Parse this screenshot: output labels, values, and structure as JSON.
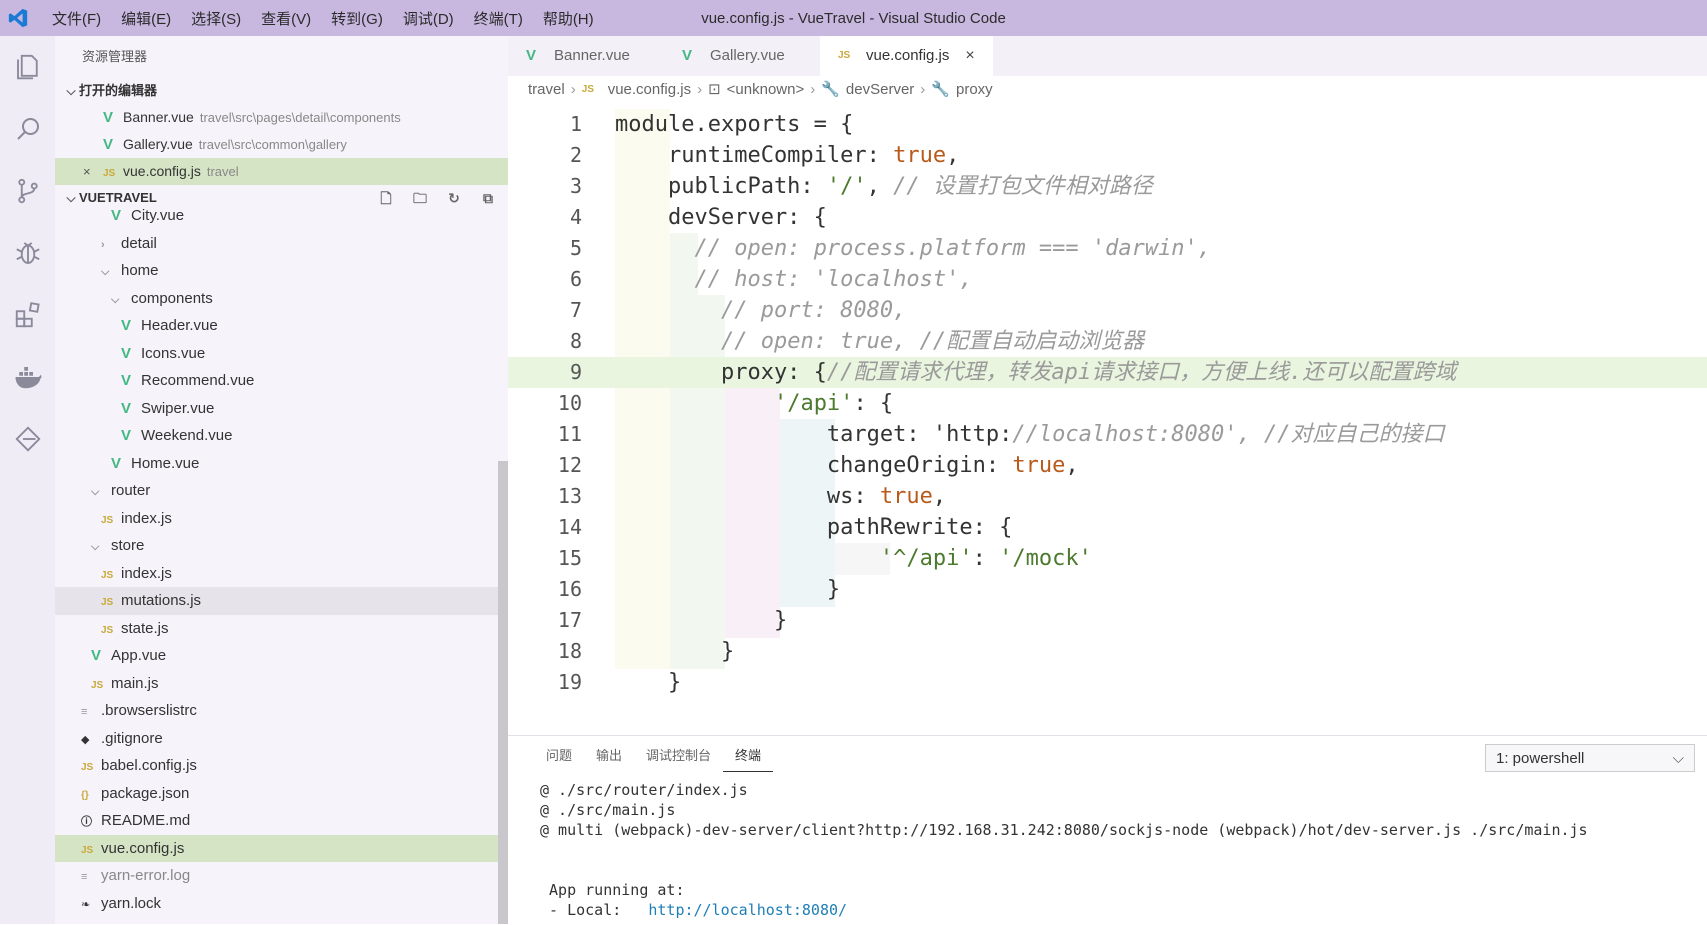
{
  "window": {
    "title": "vue.config.js - VueTravel - Visual Studio Code",
    "menu": [
      "文件(F)",
      "编辑(E)",
      "选择(S)",
      "查看(V)",
      "转到(G)",
      "调试(D)",
      "终端(T)",
      "帮助(H)"
    ]
  },
  "activity": [
    "explorer-icon",
    "search-icon",
    "source-control-icon",
    "debug-icon",
    "extensions-icon",
    "docker-icon",
    "remote-icon"
  ],
  "sidebar": {
    "title": "资源管理器",
    "open_editors_label": "打开的编辑器",
    "open_editors": [
      {
        "name": "Banner.vue",
        "path": "travel\\src\\pages\\detail\\components",
        "type": "vue"
      },
      {
        "name": "Gallery.vue",
        "path": "travel\\src\\common\\gallery",
        "type": "vue"
      },
      {
        "name": "vue.config.js",
        "path": "travel",
        "type": "js"
      }
    ],
    "project_label": "VUETRAVEL",
    "tree": [
      {
        "name": "City.vue",
        "type": "vue"
      },
      {
        "name": "detail",
        "type": "folder-closed"
      },
      {
        "name": "home",
        "type": "folder-open"
      },
      {
        "name": "components",
        "type": "folder-open"
      },
      {
        "name": "Header.vue",
        "type": "vue"
      },
      {
        "name": "Icons.vue",
        "type": "vue"
      },
      {
        "name": "Recommend.vue",
        "type": "vue"
      },
      {
        "name": "Swiper.vue",
        "type": "vue"
      },
      {
        "name": "Weekend.vue",
        "type": "vue"
      },
      {
        "name": "Home.vue",
        "type": "vue"
      },
      {
        "name": "router",
        "type": "folder-open"
      },
      {
        "name": "index.js",
        "type": "js"
      },
      {
        "name": "store",
        "type": "folder-open"
      },
      {
        "name": "index.js",
        "type": "js"
      },
      {
        "name": "mutations.js",
        "type": "js"
      },
      {
        "name": "state.js",
        "type": "js"
      },
      {
        "name": "App.vue",
        "type": "vue"
      },
      {
        "name": "main.js",
        "type": "js"
      },
      {
        "name": ".browserslistrc",
        "type": "plain"
      },
      {
        "name": ".gitignore",
        "type": "git"
      },
      {
        "name": "babel.config.js",
        "type": "js"
      },
      {
        "name": "package.json",
        "type": "json"
      },
      {
        "name": "README.md",
        "type": "info"
      },
      {
        "name": "vue.config.js",
        "type": "js"
      },
      {
        "name": "yarn-error.log",
        "type": "plain"
      },
      {
        "name": "yarn.lock",
        "type": "yarn"
      }
    ]
  },
  "tabs": [
    {
      "label": "Banner.vue",
      "type": "vue"
    },
    {
      "label": "Gallery.vue",
      "type": "vue"
    },
    {
      "label": "vue.config.js",
      "type": "js"
    }
  ],
  "breadcrumb": [
    "travel",
    "vue.config.js",
    "<unknown>",
    "devServer",
    "proxy"
  ],
  "code": {
    "lines": [
      "module.exports = {",
      "    runtimeCompiler: true,",
      "    publicPath: '/', // 设置打包文件相对路径",
      "    devServer: {",
      "      // open: process.platform === 'darwin',",
      "      // host: 'localhost',",
      "        // port: 8080,",
      "        // open: true, //配置自动启动浏览器",
      "        proxy: {//配置请求代理，转发api请求接口，方便上线.还可以配置跨域",
      "            '/api': {",
      "                target: 'http://localhost:8080', //对应自己的接口",
      "                changeOrigin: true,",
      "                ws: true,",
      "                pathRewrite: {",
      "                    '^/api': '/mock'",
      "                }",
      "            }",
      "        }",
      "    }"
    ]
  },
  "panel": {
    "tabs": [
      "问题",
      "输出",
      "调试控制台",
      "终端"
    ],
    "terminal_select": "1: powershell",
    "terminal_lines": [
      "@ ./src/router/index.js",
      "@ ./src/main.js",
      "@ multi (webpack)-dev-server/client?http://192.168.31.242:8080/sockjs-node (webpack)/hot/dev-server.js ./src/main.js",
      "",
      "",
      " App running at:",
      " - Local:   "
    ],
    "local_url": "http://localhost:8080/"
  }
}
